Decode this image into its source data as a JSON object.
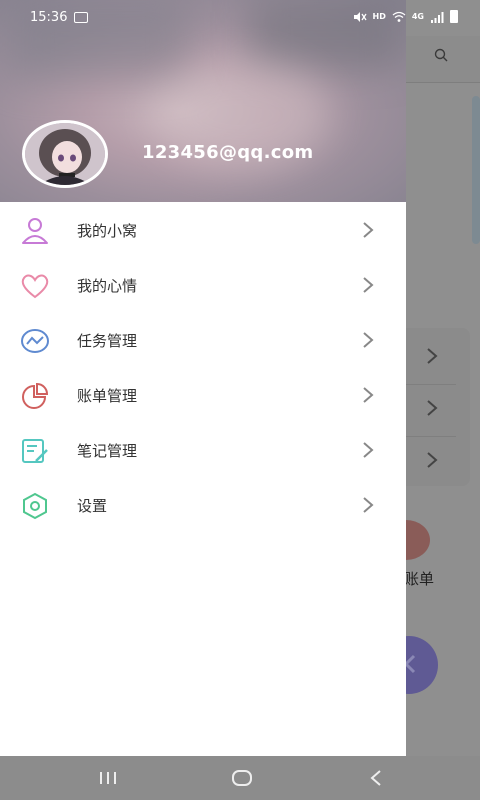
{
  "status_bar": {
    "time": "15:36",
    "network_label": "HD",
    "cell_label": "4G"
  },
  "drawer": {
    "email": "123456@qq.com",
    "menu": [
      {
        "label": "我的小窝",
        "icon": "person-icon",
        "color": "#c77ad6"
      },
      {
        "label": "我的心情",
        "icon": "heart-icon",
        "color": "#e98aa8"
      },
      {
        "label": "任务管理",
        "icon": "chart-line-icon",
        "color": "#5f8ad0"
      },
      {
        "label": "账单管理",
        "icon": "pie-chart-icon",
        "color": "#d0605e"
      },
      {
        "label": "笔记管理",
        "icon": "note-edit-icon",
        "color": "#55c7c0"
      },
      {
        "label": "设置",
        "icon": "hexagon-settings-icon",
        "color": "#4fc78f"
      }
    ]
  },
  "background_app": {
    "visible_label": "账单"
  },
  "colors": {
    "drawer_bg": "#ffffff",
    "scrim": "#8f8f8f",
    "chevron": "#888888"
  }
}
